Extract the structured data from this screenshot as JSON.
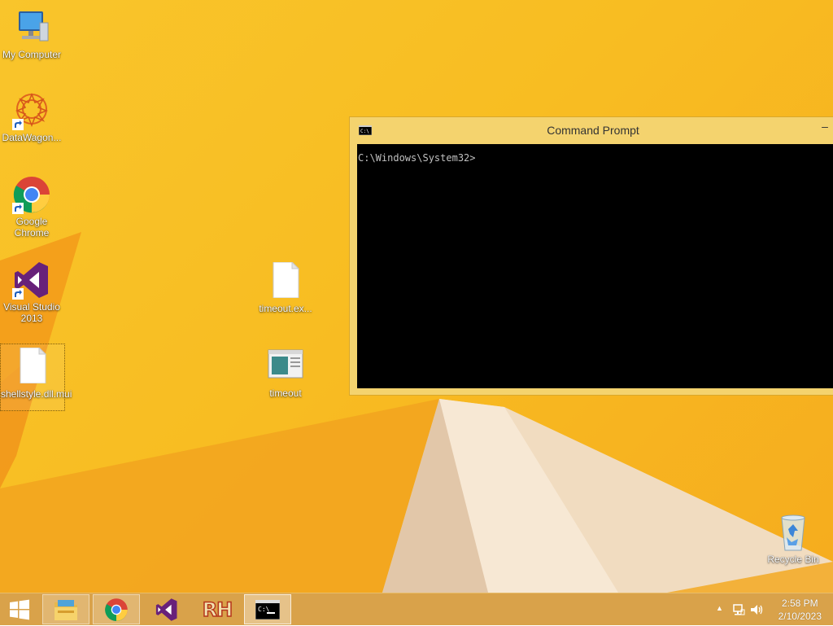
{
  "desktop": {
    "icons": [
      {
        "label": "My Computer",
        "icon": "computer-icon"
      },
      {
        "label": "DataWagon...",
        "icon": "datawagon-icon"
      },
      {
        "label": "Google Chrome",
        "icon": "chrome-icon"
      },
      {
        "label": "Visual Studio 2013",
        "icon": "visual-studio-icon"
      },
      {
        "label": "shellstyle.dll.mui",
        "icon": "file-icon"
      },
      {
        "label": "timeout.ex...",
        "icon": "file-icon"
      },
      {
        "label": "timeout",
        "icon": "window-app-icon"
      },
      {
        "label": "Recycle Bin",
        "icon": "recycle-bin-icon"
      }
    ]
  },
  "cmd_window": {
    "title": "Command Prompt",
    "minimize_glyph": "–",
    "prompt": "C:\\Windows\\System32>"
  },
  "taskbar": {
    "items": [
      {
        "icon": "windows-start-icon"
      },
      {
        "icon": "file-explorer-icon"
      },
      {
        "icon": "chrome-icon"
      },
      {
        "icon": "visual-studio-icon"
      },
      {
        "icon": "rh-icon",
        "text": "RH"
      },
      {
        "icon": "command-prompt-icon"
      }
    ],
    "tray_arrow": "▲",
    "time": "2:58 PM",
    "date": "2/10/2023"
  },
  "colors": {
    "wallpaper": "#f9c52b",
    "taskbar": "#d9a24a",
    "console_bg": "#000000",
    "console_text": "#c0c0c0",
    "window_frame": "#f4d36e"
  }
}
